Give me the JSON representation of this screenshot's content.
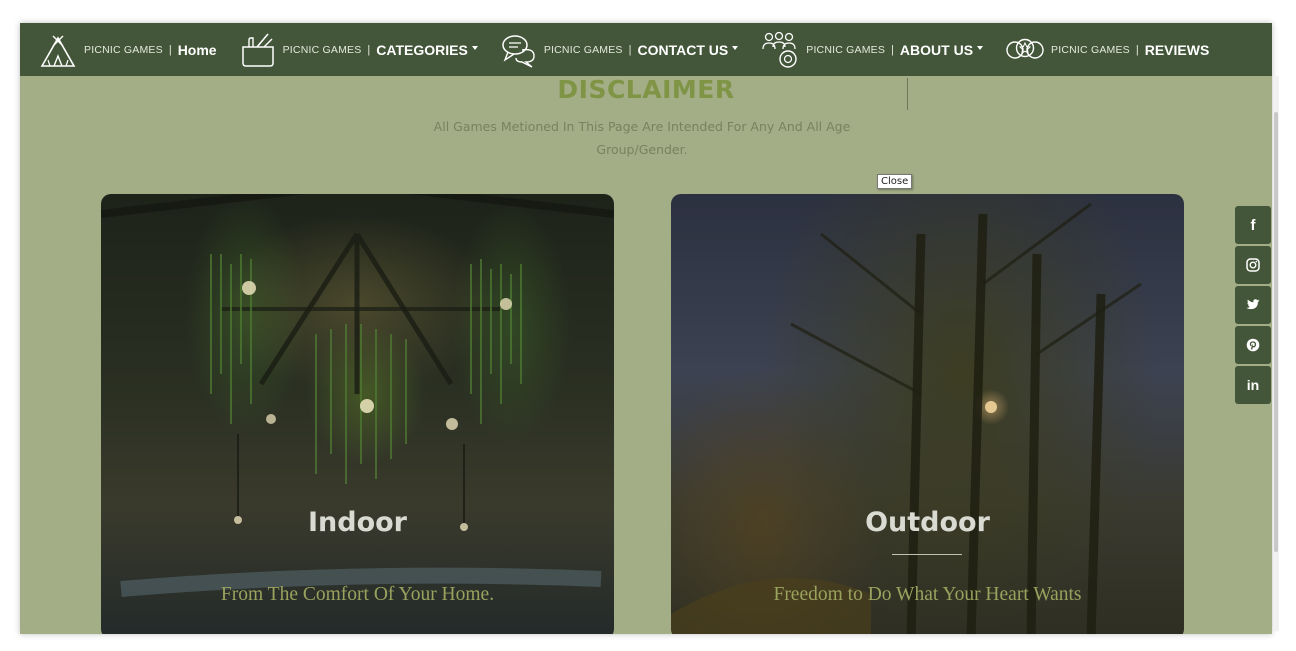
{
  "nav": {
    "brand": "PICNIC GAMES",
    "separator": "|",
    "items": [
      {
        "label": "Home",
        "icon": "tent-icon",
        "dropdown": false
      },
      {
        "label": "CATEGORIES",
        "icon": "basket-icon",
        "dropdown": true
      },
      {
        "label": "CONTACT US",
        "icon": "chat-bubbles-icon",
        "dropdown": true
      },
      {
        "label": "ABOUT US",
        "icon": "group-icon",
        "dropdown": true
      },
      {
        "label": "REVIEWS",
        "icon": "rating-icon",
        "dropdown": false
      }
    ]
  },
  "disclaimer": {
    "title": "DISCLAIMER",
    "text": "All Games Metioned In This Page Are Intended For Any And All Age Group/Gender."
  },
  "tooltip": {
    "text": "Close"
  },
  "cards": [
    {
      "title": "Indoor",
      "subtitle": "From The Comfort Of Your Home."
    },
    {
      "title": "Outdoor",
      "subtitle": "Freedom to Do What Your Heart Wants"
    }
  ],
  "social": [
    {
      "icon": "facebook-icon",
      "glyph": "f"
    },
    {
      "icon": "instagram-icon",
      "glyph": ""
    },
    {
      "icon": "twitter-icon",
      "glyph": ""
    },
    {
      "icon": "pinterest-icon",
      "glyph": ""
    },
    {
      "icon": "linkedin-icon",
      "glyph": "in"
    }
  ],
  "colors": {
    "nav_background": "#435639",
    "page_background": "#a3ad86",
    "accent_green": "#7f9444"
  }
}
